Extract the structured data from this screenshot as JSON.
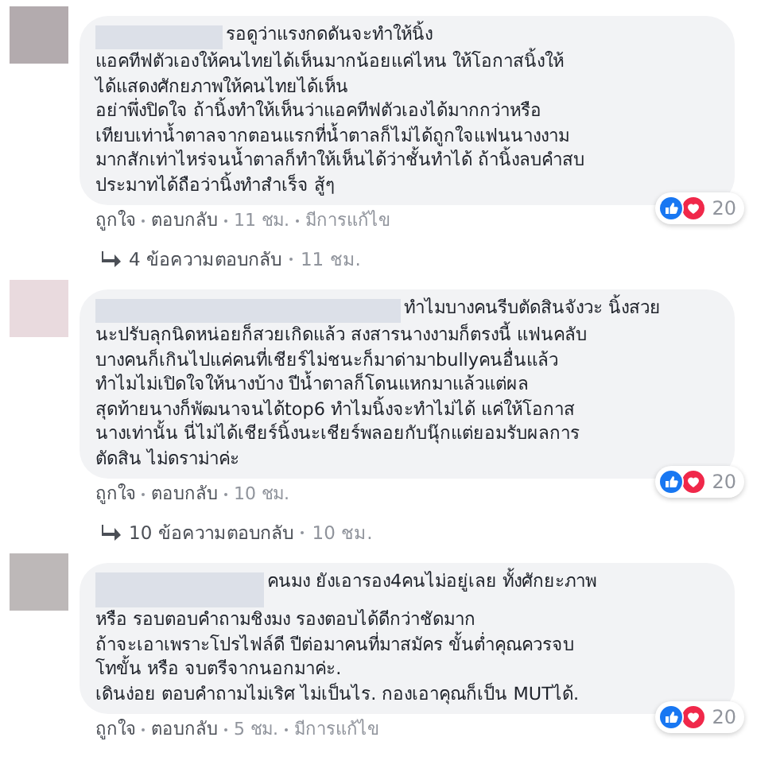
{
  "comments": [
    {
      "first_line": "รอดูว่าแรงกดดันจะทำให้นิ้ง",
      "text": "แอคทีฟตัวเองให้คนไทยได้เห็นมากน้อยแค่ไหน ให้โอกาสนิ้งให้\nได้แสดงศักยภาพให้คนไทยได้เห็น\nอย่าพึ่งปิดใจ ถ้านิ้งทำให้เห็นว่าแอคทีฟตัวเองได้มากกว่าหรือ\nเทียบเท่าน้ำตาลจากตอนแรกที่น้ำตาลก็ไม่ได้ถูกใจแฟนนางงาม\nมากสักเท่าไหร่จนน้ำตาลก็ทำให้เห็นได้ว่าชั้นทำได้ ถ้านิ้งลบคำสบ\nประมาทได้ถือว่านิ้งทำสำเร็จ สู้ๆ",
      "reaction_count": "20",
      "actions": [
        "ถูกใจ",
        "ตอบกลับ",
        "11 ชม.",
        "มีการแก้ไข"
      ],
      "replies": {
        "label": "4 ข้อความตอบกลับ",
        "time": "11 ชม."
      }
    },
    {
      "first_line": "ทำไมบางคนรีบตัดสินจังวะ นิ้งสวย",
      "text": "นะปรับลุกนิดหน่อยก็สวยเกิดแล้ว สงสารนางงามก็ตรงนี้ แฟนคลับ\nบางคนก็เกินไปแค่คนที่เชียร์ไม่ชนะก็มาด่ามาbullyคนอื่นแล้ว\nทำไมไม่เปิดใจให้นางบ้าง ปีน้ำตาลก็โดนแหกมาแล้วแต่ผล\nสุดท้ายนางก็พัฒนาจนได้top6 ทำไมนิ้งจะทำไม่ได้ แค่ให้โอกาส\nนางเท่านั้น นี่ไม่ได้เชียร์นิ้งนะเชียร์พลอยกับนุ๊กแต่ยอมรับผลการ\nตัดสิน ไม่ดราม่าค่ะ",
      "reaction_count": "20",
      "actions": [
        "ถูกใจ",
        "ตอบกลับ",
        "10 ชม."
      ],
      "replies": {
        "label": "10 ข้อความตอบกลับ",
        "time": "10 ชม."
      }
    },
    {
      "first_line": "คนมง ยังเอารอง4คนไม่อยู่เลย ทั้งศักยะภาพ",
      "text": "หรือ รอบตอบคำถามชิงมง รองตอบได้ดีกว่าชัดมาก\nถ้าจะเอาเพราะโปรไฟล์ดี ปีต่อมาคนที่มาสมัคร ขั้นต่ำคุณควรจบ\nโทขั้น หรือ จบตรีจากนอกมาค่ะ.\nเดินง่อย ตอบคำถามไม่เริศ ไม่เป็นไร. กองเอาคุณก็เป็น MUTได้.",
      "reaction_count": "20",
      "actions": [
        "ถูกใจ",
        "ตอบกลับ",
        "5 ชม.",
        "มีการแก้ไข"
      ]
    }
  ]
}
